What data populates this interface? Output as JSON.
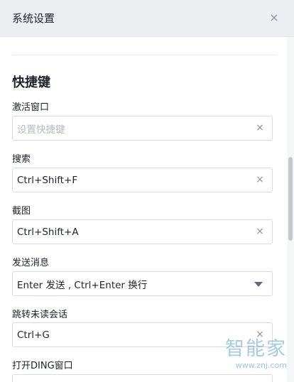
{
  "window": {
    "title": "系统设置",
    "close_glyph": "×"
  },
  "section": {
    "title": "快捷键"
  },
  "fields": [
    {
      "label": "激活窗口",
      "value": "",
      "placeholder": "设置快捷键",
      "control": "clear"
    },
    {
      "label": "搜索",
      "value": "Ctrl+Shift+F",
      "placeholder": "",
      "control": "clear"
    },
    {
      "label": "截图",
      "value": "Ctrl+Shift+A",
      "placeholder": "",
      "control": "clear"
    },
    {
      "label": "发送消息",
      "value": "Enter 发送 , Ctrl+Enter 换行",
      "placeholder": "",
      "control": "dropdown"
    },
    {
      "label": "跳转未读会话",
      "value": "Ctrl+G",
      "placeholder": "",
      "control": "clear"
    },
    {
      "label": "打开DING窗口",
      "value": "",
      "placeholder": "",
      "control": "clear"
    }
  ],
  "icons": {
    "clear": "×",
    "close": "close-icon",
    "dropdown": "caret-down-icon"
  },
  "watermark": {
    "brand": "智能家",
    "url": "www.znj.com"
  }
}
